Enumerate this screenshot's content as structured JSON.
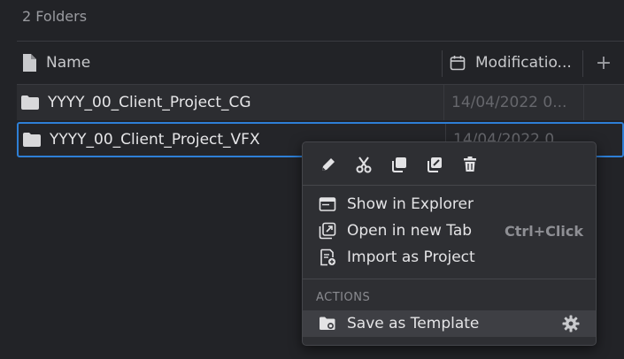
{
  "folder_count": "2 Folders",
  "header": {
    "name_label": "Name",
    "modification_label": "Modificatio...",
    "add_label": "+"
  },
  "rows": [
    {
      "name": "YYYY_00_Client_Project_CG",
      "date": "14/04/2022 0..."
    },
    {
      "name": "YYYY_00_Client_Project_VFX",
      "date": "14/04/2022 0..."
    }
  ],
  "context_menu": {
    "toolbar_icons": [
      "pencil-icon",
      "scissors-icon",
      "copy-icon",
      "duplicate-icon",
      "trash-icon"
    ],
    "items": [
      {
        "label": "Show in Explorer",
        "icon": "explorer-window-icon",
        "shortcut": ""
      },
      {
        "label": "Open in new Tab",
        "icon": "open-new-tab-icon",
        "shortcut": "Ctrl+Click"
      },
      {
        "label": "Import as Project",
        "icon": "import-project-icon",
        "shortcut": ""
      }
    ],
    "section_label": "ACTIONS",
    "actions": [
      {
        "label": "Save as Template",
        "icon": "folder-template-icon",
        "settings_icon": "gear-icon"
      }
    ]
  },
  "colors": {
    "background": "#222327",
    "selection_border": "#2e7fd6",
    "menu_background": "#2e2f33"
  }
}
